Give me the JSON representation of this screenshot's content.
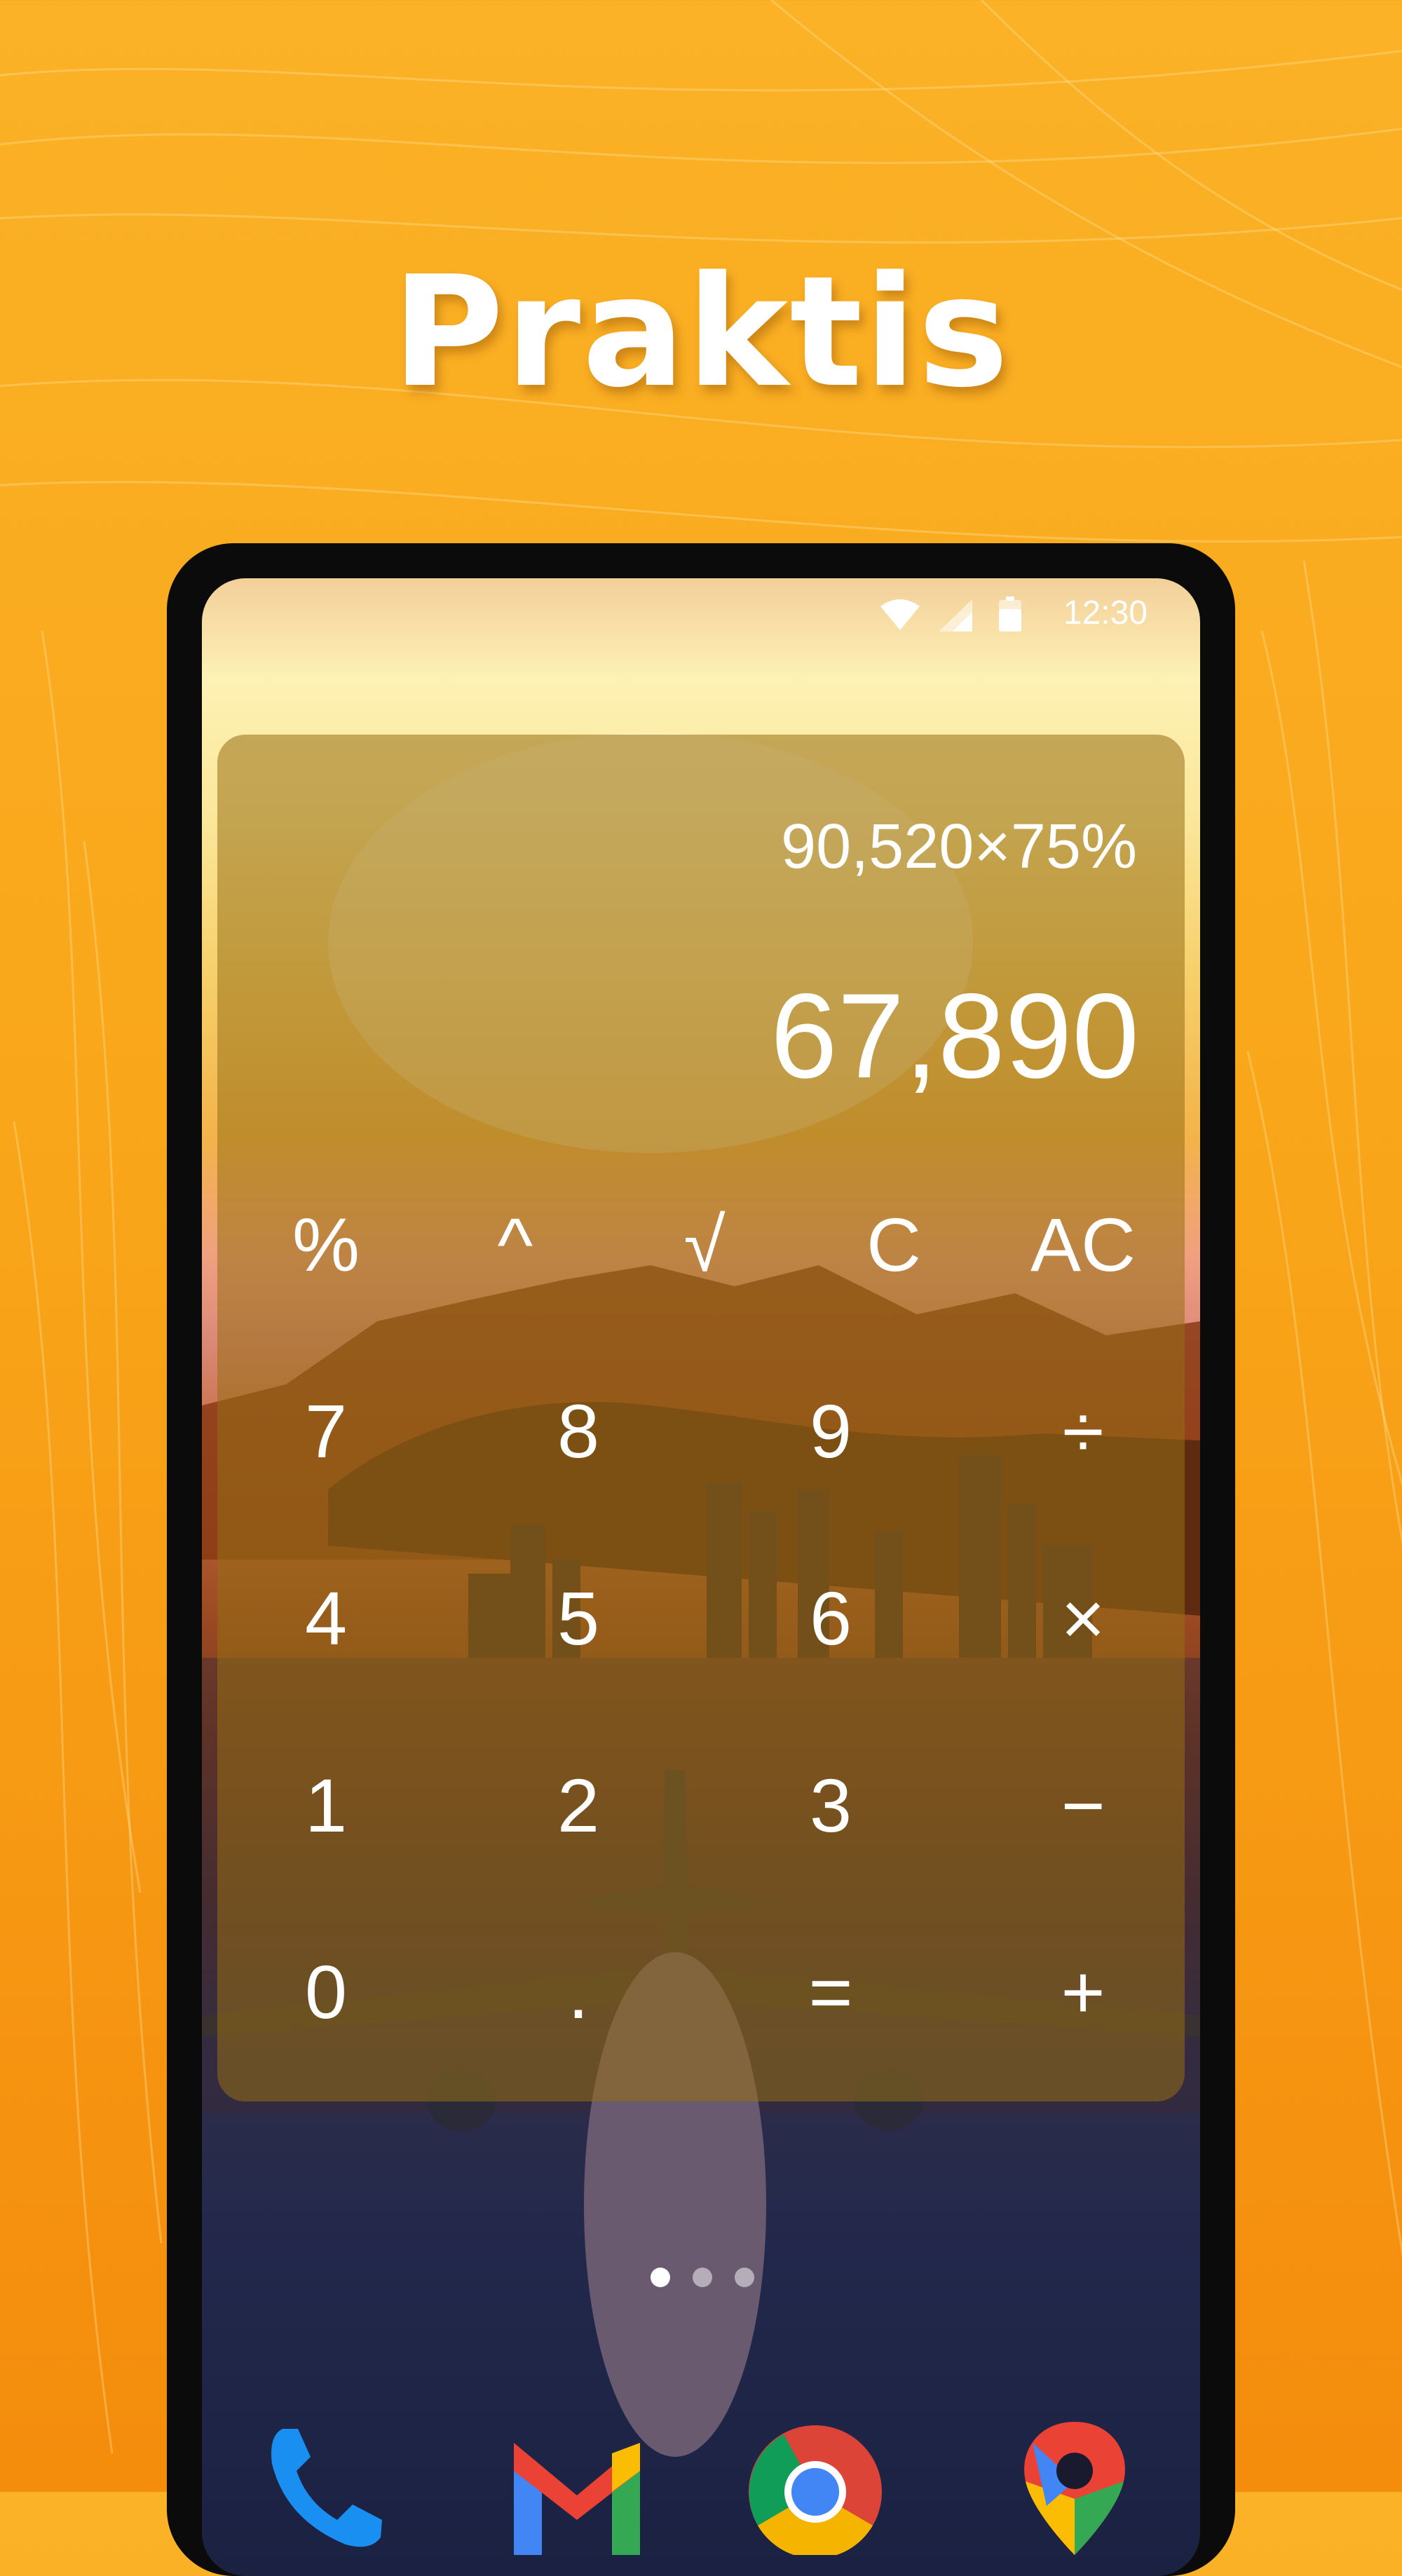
{
  "headline": "Praktis",
  "status": {
    "time": "12:30",
    "icons": [
      "wifi-icon",
      "signal-icon",
      "battery-icon"
    ]
  },
  "calculator": {
    "expression": "90,520×75%",
    "result": "67,890",
    "keys": [
      "%",
      "^",
      "√",
      "C",
      "AC",
      "7",
      "8",
      "9",
      "÷",
      "4",
      "5",
      "6",
      "×",
      "1",
      "2",
      "3",
      "−",
      "0",
      ".",
      "=",
      "+"
    ]
  },
  "page_indicator": {
    "count": 3,
    "active": 1
  },
  "dock": [
    "phone-icon",
    "gmail-icon",
    "chrome-icon",
    "maps-icon"
  ],
  "colors": {
    "background": "#f9a61a",
    "card": "#96701a",
    "text": "#ffffff"
  }
}
